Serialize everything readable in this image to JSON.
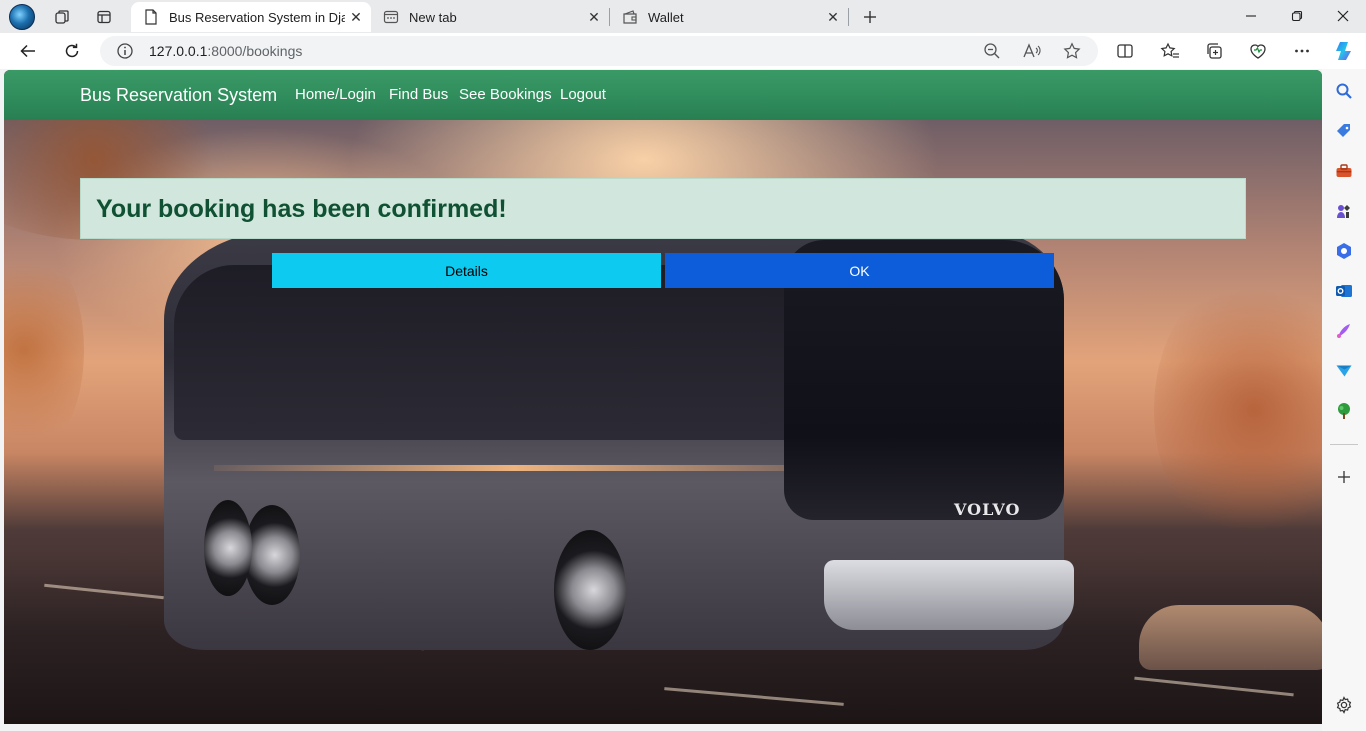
{
  "browser": {
    "tabs": [
      {
        "title": "Bus Reservation System in Django",
        "active": true,
        "icon": "page-icon"
      },
      {
        "title": "New tab",
        "active": false,
        "icon": "new-tab-icon"
      },
      {
        "title": "Wallet",
        "active": false,
        "icon": "wallet-icon"
      }
    ],
    "address": {
      "host": "127.0.0.1",
      "rest": ":8000/bookings"
    }
  },
  "navbar": {
    "brand": "Bus Reservation System",
    "links": [
      "Home/Login",
      "Find Bus",
      "See Bookings",
      "Logout"
    ],
    "color": "#2f8b5b"
  },
  "alert": {
    "message": "Your booking has been confirmed!",
    "bg": "#d1e7dd",
    "color": "#0f5132"
  },
  "buttons": {
    "details": "Details",
    "ok": "OK"
  },
  "hero": {
    "bus_logo": "VOLVO"
  },
  "sidebar": {
    "icons": [
      "search-icon",
      "shopping-tag-icon",
      "tools-icon",
      "games-icon",
      "copilot-icon",
      "outlook-icon",
      "designer-icon",
      "send-icon",
      "tree-icon",
      "add-icon",
      "settings-icon"
    ]
  }
}
